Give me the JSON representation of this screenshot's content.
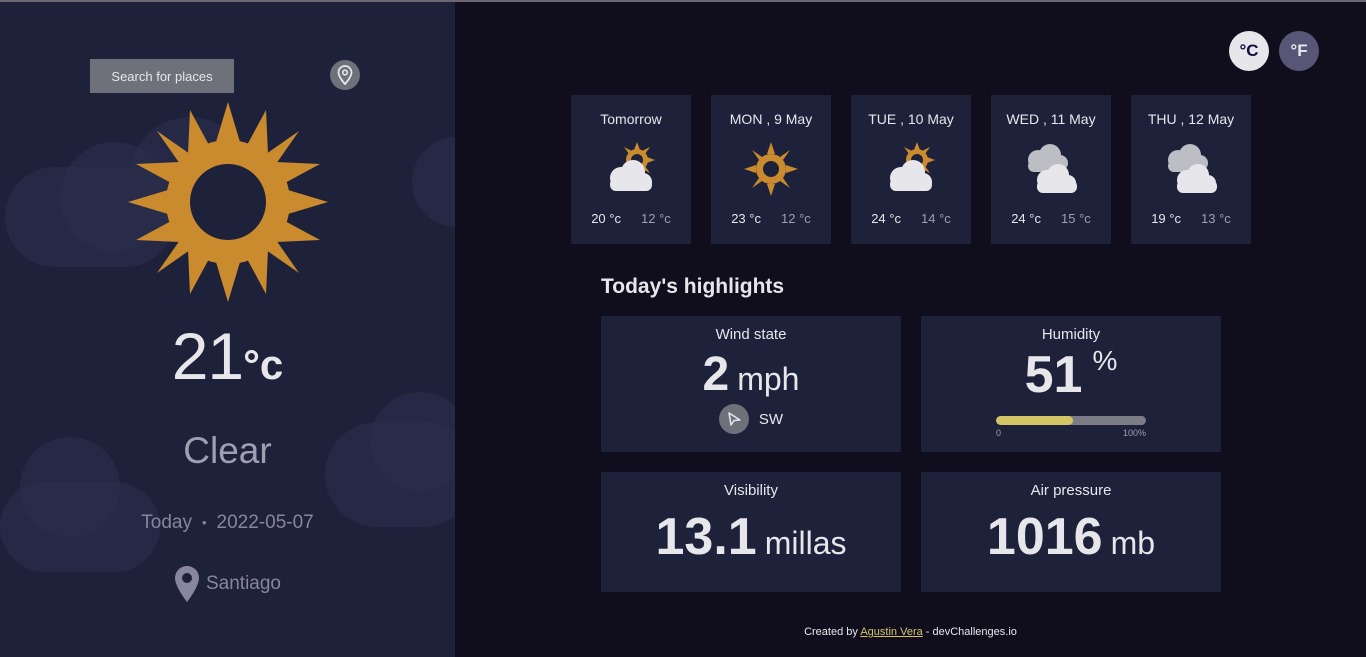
{
  "sidebar": {
    "search_label": "Search for places",
    "temperature": "21",
    "temperature_unit": "°c",
    "condition": "Clear",
    "date_prefix": "Today",
    "separator": "•",
    "date": "2022-05-07",
    "city": "Santiago",
    "weather_icon": "sun-icon"
  },
  "units": {
    "celsius": "°C",
    "fahrenheit": "°F"
  },
  "forecast": [
    {
      "day": "Tomorrow",
      "icon": "light-cloud-icon",
      "max": "20",
      "min": "12",
      "unit": "°c"
    },
    {
      "day": "MON , 9 May",
      "icon": "sun-icon",
      "max": "23",
      "min": "12",
      "unit": "°c"
    },
    {
      "day": "TUE , 10 May",
      "icon": "light-cloud-icon",
      "max": "24",
      "min": "14",
      "unit": "°c"
    },
    {
      "day": "WED , 11 May",
      "icon": "heavy-cloud-icon",
      "max": "24",
      "min": "15",
      "unit": "°c"
    },
    {
      "day": "THU , 12 May",
      "icon": "heavy-cloud-icon",
      "max": "19",
      "min": "13",
      "unit": "°c"
    }
  ],
  "highlights": {
    "title": "Today's highlights",
    "wind": {
      "label": "Wind state",
      "value": "2",
      "unit": "mph",
      "direction": "SW"
    },
    "humidity": {
      "label": "Humidity",
      "value": "51",
      "unit": "%",
      "percent": 51,
      "scale_min": "0",
      "scale_max": "100%"
    },
    "visibility": {
      "label": "Visibility",
      "value": "13.1",
      "unit": "millas"
    },
    "pressure": {
      "label": "Air pressure",
      "value": "1016",
      "unit": "mb"
    }
  },
  "footer": {
    "prefix": "Created by",
    "author": "Agustin Vera",
    "suffix": "- devChallenges.io"
  },
  "colors": {
    "accent": "#d3c566",
    "sun": "#c98b2e",
    "panel": "#1e213a",
    "background": "#100e1d"
  }
}
